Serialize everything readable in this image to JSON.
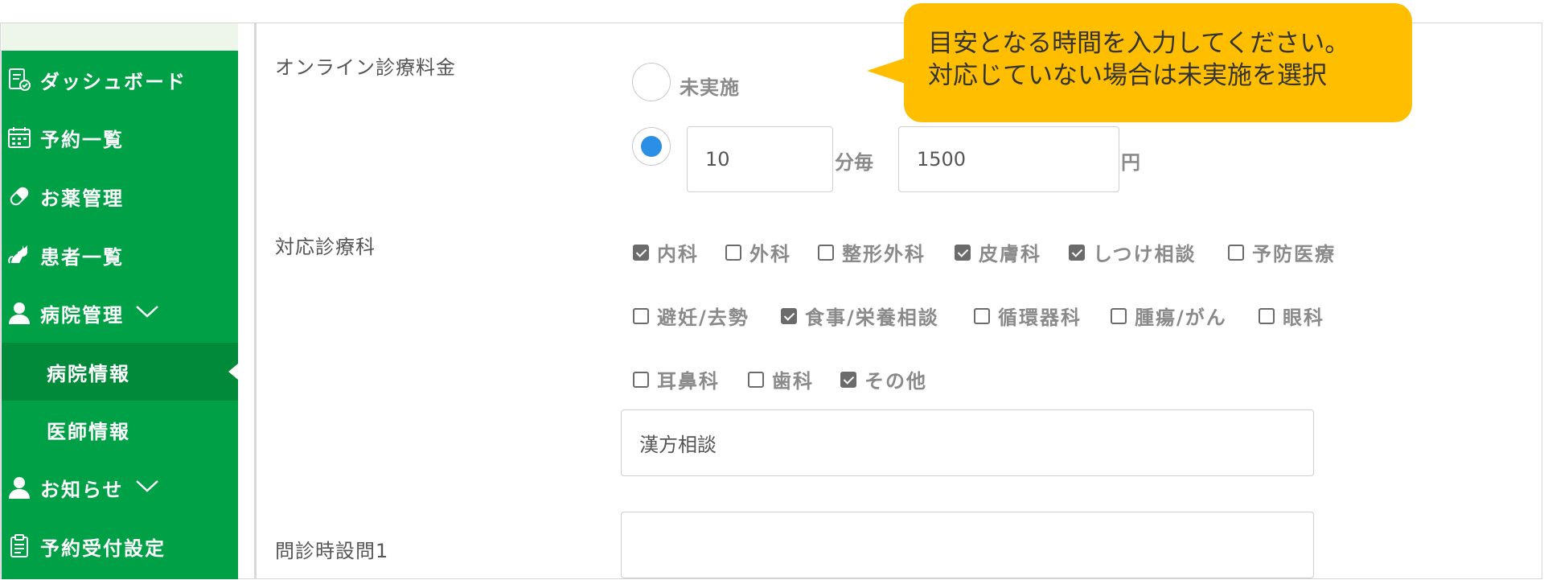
{
  "sidebar": {
    "items": [
      {
        "label": "ダッシュボード",
        "icon": "dashboard-doc-icon"
      },
      {
        "label": "予約一覧",
        "icon": "calendar-icon"
      },
      {
        "label": "お薬管理",
        "icon": "pill-icon"
      },
      {
        "label": "患者一覧",
        "icon": "cat-icon"
      },
      {
        "label": "病院管理",
        "icon": "person-icon",
        "expandable": true
      },
      {
        "label": "病院情報",
        "sub": true,
        "active": true
      },
      {
        "label": "医師情報",
        "sub": true
      },
      {
        "label": "お知らせ",
        "icon": "person-icon",
        "expandable": true
      },
      {
        "label": "予約受付設定",
        "icon": "clipboard-icon"
      }
    ],
    "chevron": "﹀"
  },
  "form": {
    "fee": {
      "label": "オンライン診療料金",
      "option_none": "未実施",
      "minutes_value": "10",
      "minutes_unit": "分毎",
      "price_value": "1500",
      "price_unit": "円"
    },
    "departments": {
      "label": "対応診療科",
      "items": [
        {
          "label": "内科",
          "checked": true
        },
        {
          "label": "外科",
          "checked": false
        },
        {
          "label": "整形外科",
          "checked": false
        },
        {
          "label": "皮膚科",
          "checked": true
        },
        {
          "label": "しつけ相談",
          "checked": true
        },
        {
          "label": "予防医療",
          "checked": false
        },
        {
          "label": "避妊/去勢",
          "checked": false
        },
        {
          "label": "食事/栄養相談",
          "checked": true
        },
        {
          "label": "循環器科",
          "checked": false
        },
        {
          "label": "腫瘍/がん",
          "checked": false
        },
        {
          "label": "眼科",
          "checked": false
        },
        {
          "label": "耳鼻科",
          "checked": false
        },
        {
          "label": "歯科",
          "checked": false
        },
        {
          "label": "その他",
          "checked": true
        }
      ],
      "other_value": "漢方相談"
    },
    "question1": {
      "label": "問診時設問1",
      "value": ""
    }
  },
  "tooltip": {
    "line1": "目安となる時間を入力してください。",
    "line2": "対応じていない場合は未実施を選択"
  },
  "colors": {
    "sidebar": "#00a046",
    "sidebar_active": "#008a3a",
    "tooltip": "#ffbf00",
    "radio_selected": "#2b8fe6"
  }
}
